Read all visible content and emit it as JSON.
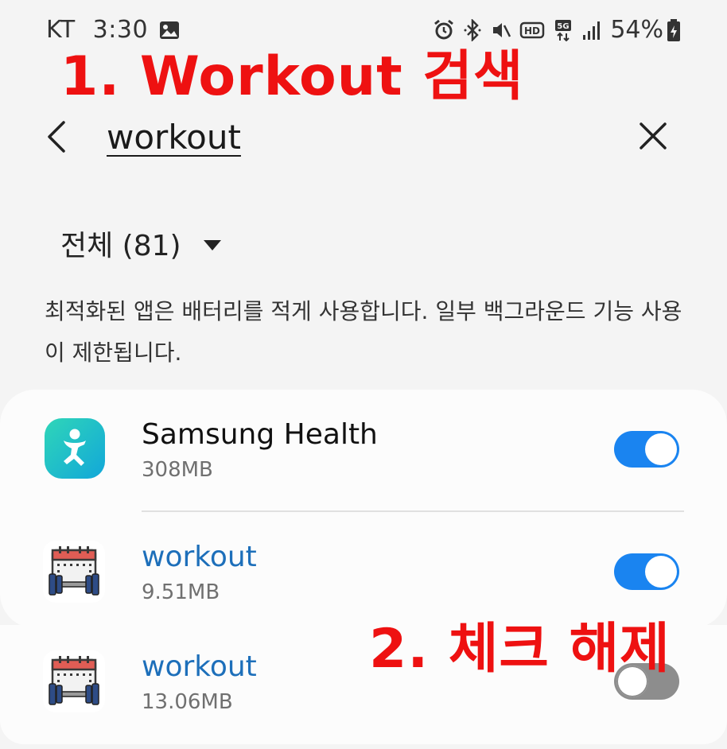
{
  "status_bar": {
    "carrier": "KT",
    "time": "3:30",
    "network": "5G",
    "battery": "54%"
  },
  "annotations": {
    "step1": "1. Workout 검색",
    "step2": "2. 체크 해제"
  },
  "search": {
    "query": "workout"
  },
  "filter": {
    "label": "전체 (81)"
  },
  "description": "최적화된 앱은 배터리를 적게 사용합니다. 일부 백그라운드 기능 사용이 제한됩니다.",
  "apps": [
    {
      "name": "Samsung Health",
      "size": "308MB",
      "optimized": true,
      "icon": "samsung-health-icon"
    },
    {
      "name": "workout",
      "size": "9.51MB",
      "optimized": true,
      "icon": "workout-calendar-dumbbell-icon"
    },
    {
      "name": "workout",
      "size": "13.06MB",
      "optimized": false,
      "icon": "workout-calendar-dumbbell-icon"
    }
  ],
  "colors": {
    "toggle_on": "#1a84f0",
    "toggle_off": "#8d8d8d",
    "annotation": "#ee1111",
    "highlight_text": "#1d6fba"
  }
}
